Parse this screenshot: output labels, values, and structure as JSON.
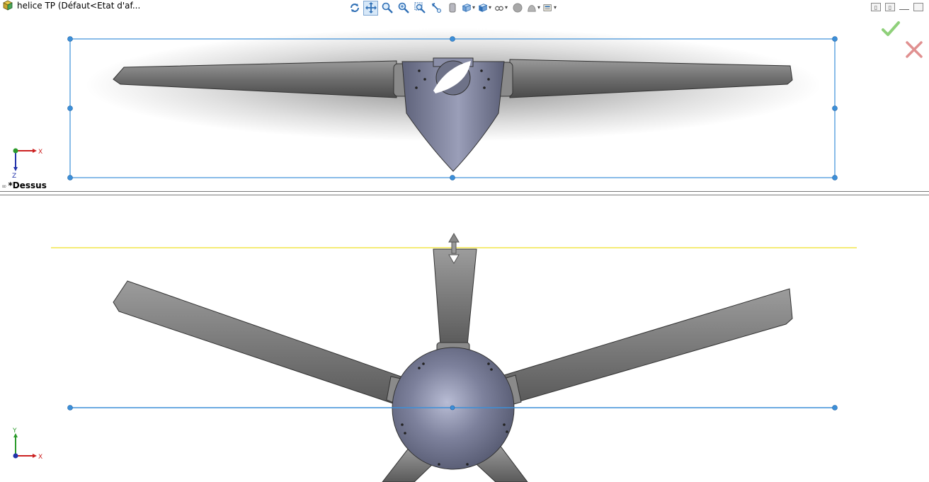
{
  "document": {
    "title": "helice TP  (Défaut<Etat d'af..."
  },
  "toolbar": {
    "items": [
      {
        "name": "rotate-view",
        "icon": "rotate-icon"
      },
      {
        "name": "pan",
        "icon": "pan-icon",
        "active": true
      },
      {
        "name": "zoom-in-out",
        "icon": "zoom-in-out-icon"
      },
      {
        "name": "zoom-to-fit",
        "icon": "zoom-fit-icon"
      },
      {
        "name": "zoom-to-area",
        "icon": "zoom-area-icon"
      },
      {
        "name": "previous-view",
        "icon": "previous-view-icon"
      },
      {
        "name": "section-view",
        "icon": "section-view-icon"
      },
      {
        "name": "view-orientation",
        "icon": "view-orientation-icon",
        "dropdown": true
      },
      {
        "name": "display-style",
        "icon": "display-style-icon",
        "dropdown": true
      },
      {
        "name": "hide-show-items",
        "icon": "hide-show-icon",
        "dropdown": true
      },
      {
        "name": "edit-appearance",
        "icon": "appearance-icon"
      },
      {
        "name": "apply-scene",
        "icon": "scene-icon",
        "dropdown": true
      },
      {
        "name": "view-settings",
        "icon": "view-settings-icon",
        "dropdown": true
      }
    ]
  },
  "viewports": {
    "top": {
      "label": "*Dessus",
      "axis_h": "X",
      "axis_v": "Z"
    },
    "front": {
      "axis_h": "X",
      "axis_v": "Y"
    }
  },
  "colors": {
    "selection_box": "#3b8fd9",
    "sketch_line": "#f2e64a",
    "confirm": "#8fd07a",
    "cancel": "#e09090",
    "axis_x": "#cc2222",
    "axis_y": "#2a9a2a",
    "axis_z": "#2233aa",
    "hub": "#7a7f9a",
    "blade": "#7d7d7d"
  }
}
